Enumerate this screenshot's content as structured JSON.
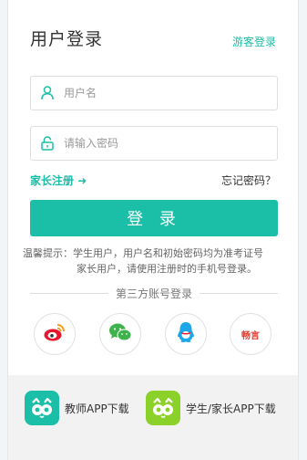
{
  "header": {
    "title": "用户登录",
    "guest_login": "游客登录"
  },
  "form": {
    "username_placeholder": "用户名",
    "password_placeholder": "请输入密码",
    "parent_register": "家长注册",
    "forgot_password": "忘记密码？",
    "login_button": "登 录"
  },
  "tips": {
    "line1": "温馨提示：学生用户，用户名和初始密码均为准考证号",
    "line2": "家长用户，请使用注册时的手机号登录。"
  },
  "third_party": {
    "label": "第三方账号登录",
    "providers": [
      "weibo-icon",
      "wechat-icon",
      "qq-icon",
      "yixin-icon"
    ],
    "yixin_text": "畅言"
  },
  "footer": {
    "teacher_app": "教师APP下载",
    "student_app": "学生/家长APP下载"
  },
  "colors": {
    "accent": "#1bbfa8",
    "weibo": "#e6162d",
    "wechat": "#3fb34b",
    "qq": "#1ea7e8",
    "student_app": "#8bd12a"
  }
}
